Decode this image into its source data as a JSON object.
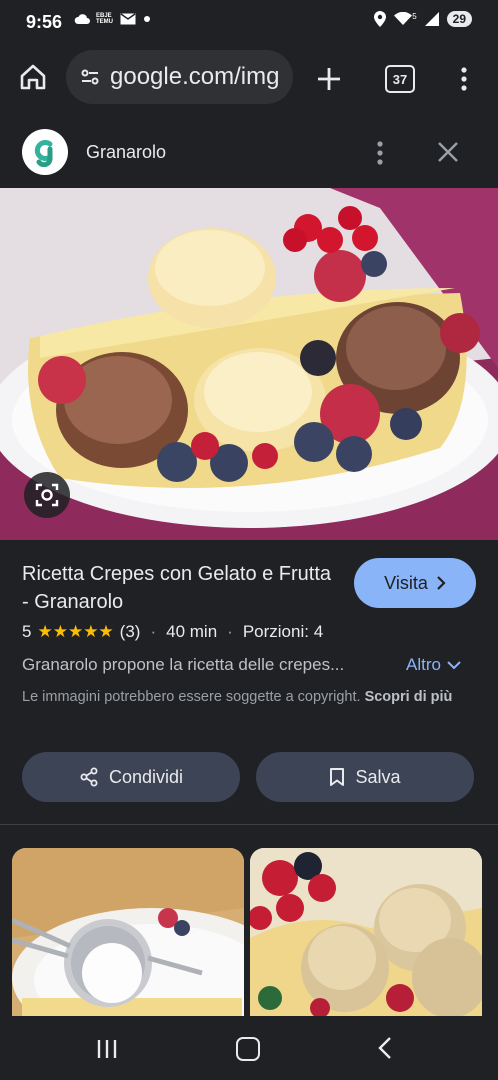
{
  "status_bar": {
    "time": "9:56",
    "temu_label": "EBJE TEMU",
    "battery": "29",
    "wifi_label": "5"
  },
  "browser": {
    "url": "google.com/img",
    "tab_count": "37"
  },
  "site": {
    "name": "Granarolo",
    "logo_letter": "g",
    "brand_color": "#33b39b"
  },
  "result": {
    "title": "Ricetta Crepes con Gelato e Frutta - Granarolo",
    "visit_label": "Visita",
    "rating_value": "5",
    "stars": "★★★★★",
    "rating_count": "(3)",
    "time": "40 min",
    "portions": "Porzioni: 4",
    "description": "Granarolo propone la ricetta delle crepes...",
    "more_label": "Altro",
    "copyright_text": "Le immagini potrebbero essere soggette a copyright.",
    "learn_more": "Scopri di più",
    "share_label": "Condividi",
    "save_label": "Salva"
  },
  "colors": {
    "background": "#202124",
    "accent": "#8ab4f8",
    "button_bg": "#3c4455",
    "star": "#fbbc04"
  }
}
